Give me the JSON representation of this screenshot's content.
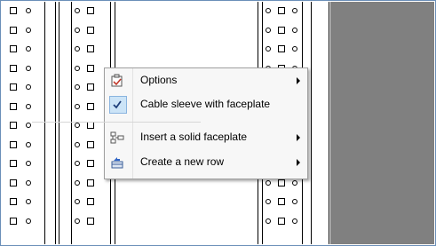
{
  "menu": {
    "items": [
      {
        "label": "Options",
        "icon": "options-icon",
        "submenu": true,
        "checked": false
      },
      {
        "label": "Cable sleeve  with faceplate",
        "icon": "checkmark-icon",
        "submenu": false,
        "checked": true
      },
      {
        "label": "Insert a solid faceplate",
        "icon": "faceplate-icon",
        "submenu": true,
        "checked": false
      },
      {
        "label": "Create a new row",
        "icon": "new-row-icon",
        "submenu": true,
        "checked": false
      }
    ]
  },
  "colors": {
    "background_panel": "#808080",
    "frame_border": "#6b8fb8",
    "check_highlight": "#cce4f7",
    "menu_bg": "#f7f7f7"
  }
}
